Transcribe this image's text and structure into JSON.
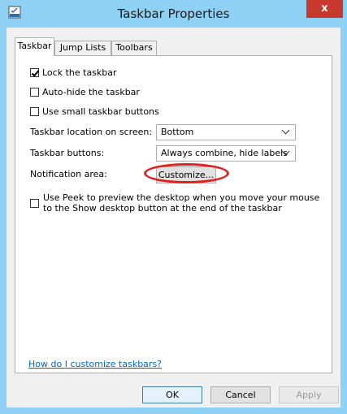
{
  "window": {
    "title": "Taskbar Properties",
    "close_glyph": "x",
    "accent_color": "#8fd1f5",
    "close_color": "#c7382d"
  },
  "tabs": [
    {
      "label": "Taskbar",
      "active": true
    },
    {
      "label": "Jump Lists",
      "active": false
    },
    {
      "label": "Toolbars",
      "active": false
    }
  ],
  "options": {
    "lock": {
      "label": "Lock the taskbar",
      "checked": true
    },
    "autohide": {
      "label": "Auto-hide the taskbar",
      "checked": false
    },
    "small": {
      "label": "Use small taskbar buttons",
      "checked": false
    }
  },
  "location": {
    "label": "Taskbar location on screen:",
    "value": "Bottom"
  },
  "buttons_setting": {
    "label": "Taskbar buttons:",
    "value": "Always combine, hide labels"
  },
  "notification": {
    "label": "Notification area:",
    "button": "Customize..."
  },
  "peek": {
    "label": "Use Peek to preview the desktop when you move your mouse to the Show desktop button at the end of the taskbar",
    "checked": false
  },
  "help_link": "How do I customize taskbars?",
  "footer": {
    "ok": "OK",
    "cancel": "Cancel",
    "apply": "Apply"
  },
  "icons": {
    "app": "taskbar-app-icon",
    "close": "close-icon",
    "chevron": "chevron-down-icon",
    "check": "check-icon",
    "highlight": "annotation-circle"
  }
}
